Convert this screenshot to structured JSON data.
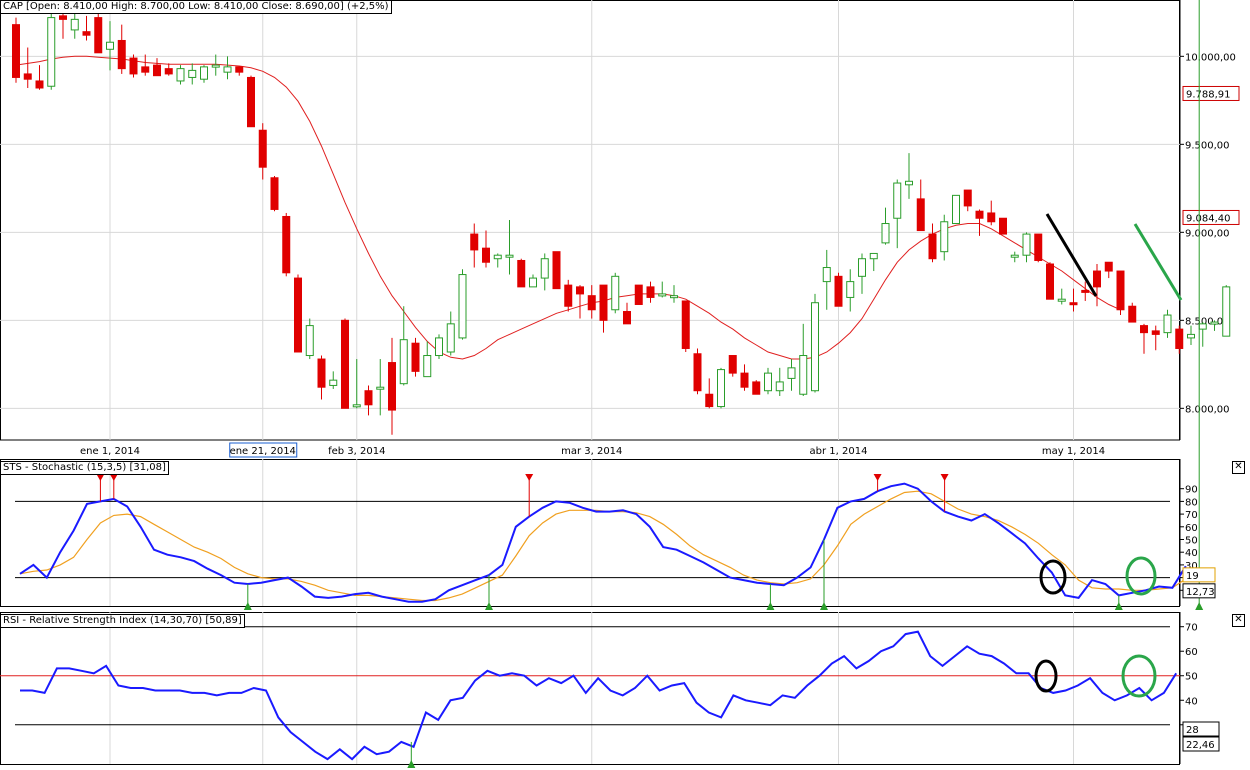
{
  "colors": {
    "up": "#2a9d2a",
    "down": "#e00000",
    "ma": "#e02020",
    "stoch_k": "#1a1aff",
    "stoch_d": "#f0a020",
    "rsi": "#1a1aff",
    "annot_black": "#000000",
    "annot_green": "#2aa64a"
  },
  "chart_data": [
    {
      "type": "candlestick",
      "title": "CAP [Open: 8.410,00 High: 8.700,00 Low: 8.410,00 Close: 8.690,00] (+2,5%)",
      "ylim": [
        7820,
        10320
      ],
      "y_ticks": [
        {
          "v": 8000,
          "t": "8.000,00"
        },
        {
          "v": 8500,
          "t": "8.500,00"
        },
        {
          "v": 9000,
          "t": "9.000,00"
        },
        {
          "v": 9500,
          "t": "9.500,00"
        },
        {
          "v": 10000,
          "t": "10.000,00"
        }
      ],
      "value_markers": [
        {
          "v": 9788.91,
          "t": "9.788,91",
          "color": "#cc0000"
        },
        {
          "v": 9084.4,
          "t": "9.084,40",
          "color": "#cc0000"
        }
      ],
      "x_labels": [
        {
          "i": 8,
          "t": "ene 1, 2014"
        },
        {
          "i": 21,
          "t": "ene 21, 2014",
          "boxed": true
        },
        {
          "i": 29,
          "t": "feb 3, 2014"
        },
        {
          "i": 49,
          "t": "mar 3, 2014"
        },
        {
          "i": 70,
          "t": "abr 1, 2014"
        },
        {
          "i": 90,
          "t": "may 1, 2014"
        }
      ],
      "candles": [
        [
          10180,
          10220,
          9850,
          9880
        ],
        [
          9900,
          10050,
          9820,
          9870
        ],
        [
          9860,
          9950,
          9810,
          9820
        ],
        [
          9830,
          10260,
          9810,
          10220
        ],
        [
          10230,
          10290,
          10100,
          10210
        ],
        [
          10150,
          10290,
          10100,
          10210
        ],
        [
          10140,
          10230,
          10090,
          10120
        ],
        [
          10220,
          10300,
          10020,
          10020
        ],
        [
          10040,
          10200,
          9920,
          10080
        ],
        [
          10090,
          10180,
          9900,
          9930
        ],
        [
          9990,
          10010,
          9880,
          9900
        ],
        [
          9940,
          10010,
          9890,
          9910
        ],
        [
          9950,
          9990,
          9890,
          9890
        ],
        [
          9930,
          9960,
          9890,
          9900
        ],
        [
          9860,
          9950,
          9840,
          9930
        ],
        [
          9880,
          9960,
          9840,
          9920
        ],
        [
          9870,
          9950,
          9850,
          9940
        ],
        [
          9940,
          10010,
          9890,
          9950
        ],
        [
          9910,
          10000,
          9870,
          9940
        ],
        [
          9940,
          9930,
          9890,
          9910
        ],
        [
          9880,
          9890,
          9600,
          9600
        ],
        [
          9580,
          9620,
          9300,
          9370
        ],
        [
          9310,
          9320,
          9120,
          9130
        ],
        [
          9090,
          9110,
          8750,
          8770
        ],
        [
          8740,
          8760,
          8320,
          8320
        ],
        [
          8300,
          8510,
          8280,
          8470
        ],
        [
          8280,
          8300,
          8050,
          8120
        ],
        [
          8130,
          8210,
          8110,
          8160
        ],
        [
          8500,
          8510,
          8000,
          8000
        ],
        [
          8010,
          8280,
          8000,
          8020
        ],
        [
          8100,
          8130,
          7960,
          8020
        ],
        [
          8120,
          8280,
          7960,
          8120
        ],
        [
          8260,
          8400,
          7850,
          7990
        ],
        [
          8140,
          8580,
          8130,
          8390
        ],
        [
          8370,
          8400,
          8180,
          8210
        ],
        [
          8180,
          8380,
          8180,
          8300
        ],
        [
          8300,
          8420,
          8280,
          8400
        ],
        [
          8320,
          8550,
          8300,
          8480
        ],
        [
          8400,
          8790,
          8390,
          8760
        ],
        [
          8990,
          9050,
          8800,
          8900
        ],
        [
          8910,
          9010,
          8800,
          8830
        ],
        [
          8850,
          8880,
          8800,
          8870
        ],
        [
          8870,
          9070,
          8760,
          8870
        ],
        [
          8840,
          8850,
          8700,
          8690
        ],
        [
          8690,
          8760,
          8690,
          8740
        ],
        [
          8740,
          8880,
          8670,
          8850
        ],
        [
          8890,
          8890,
          8800,
          8680
        ],
        [
          8700,
          8730,
          8550,
          8580
        ],
        [
          8690,
          8700,
          8510,
          8650
        ],
        [
          8640,
          8700,
          8510,
          8560
        ],
        [
          8700,
          8700,
          8430,
          8500
        ],
        [
          8560,
          8770,
          8540,
          8750
        ],
        [
          8550,
          8600,
          8500,
          8480
        ],
        [
          8700,
          8700,
          8610,
          8590
        ],
        [
          8690,
          8720,
          8600,
          8630
        ],
        [
          8650,
          8720,
          8630,
          8650
        ],
        [
          8640,
          8700,
          8600,
          8640
        ],
        [
          8610,
          8600,
          8320,
          8340
        ],
        [
          8310,
          8340,
          8080,
          8100
        ],
        [
          8080,
          8170,
          8000,
          8010
        ],
        [
          8010,
          8230,
          8000,
          8220
        ],
        [
          8300,
          8300,
          8180,
          8200
        ],
        [
          8200,
          8250,
          8100,
          8120
        ],
        [
          8150,
          8160,
          8100,
          8080
        ],
        [
          8100,
          8230,
          8080,
          8200
        ],
        [
          8100,
          8230,
          8070,
          8150
        ],
        [
          8170,
          8280,
          8100,
          8230
        ],
        [
          8080,
          8480,
          8070,
          8300
        ],
        [
          8100,
          8650,
          8090,
          8600
        ],
        [
          8720,
          8900,
          8560,
          8800
        ],
        [
          8750,
          8770,
          8660,
          8580
        ],
        [
          8630,
          8790,
          8550,
          8720
        ],
        [
          8750,
          8880,
          8650,
          8850
        ],
        [
          8850,
          8880,
          8780,
          8880
        ],
        [
          8940,
          9140,
          8930,
          9050
        ],
        [
          9080,
          9300,
          8910,
          9280
        ],
        [
          9270,
          9450,
          9190,
          9290
        ],
        [
          9190,
          9300,
          9020,
          9010
        ],
        [
          8990,
          9050,
          8830,
          8850
        ],
        [
          8890,
          9100,
          8840,
          9060
        ],
        [
          9050,
          9200,
          9050,
          9210
        ],
        [
          9240,
          9220,
          9120,
          9150
        ],
        [
          9120,
          9130,
          8980,
          9080
        ],
        [
          9110,
          9180,
          9040,
          9060
        ],
        [
          9080,
          9070,
          9000,
          8990
        ],
        [
          8860,
          8890,
          8830,
          8870
        ],
        [
          8870,
          9000,
          8830,
          8990
        ],
        [
          8990,
          8990,
          8830,
          8840
        ],
        [
          8820,
          8830,
          8620,
          8620
        ],
        [
          8620,
          8680,
          8590,
          8620
        ],
        [
          8600,
          8680,
          8550,
          8590
        ],
        [
          8670,
          8720,
          8610,
          8660
        ],
        [
          8780,
          8820,
          8580,
          8690
        ],
        [
          8830,
          8820,
          8740,
          8780
        ],
        [
          8780,
          8750,
          8530,
          8560
        ],
        [
          8580,
          8600,
          8500,
          8490
        ],
        [
          8470,
          8480,
          8310,
          8430
        ],
        [
          8440,
          8470,
          8330,
          8420
        ],
        [
          8430,
          8560,
          8400,
          8530
        ],
        [
          8450,
          8470,
          8310,
          8340
        ],
        [
          8400,
          8470,
          8360,
          8420
        ],
        [
          8450,
          8490,
          8350,
          8480
        ],
        [
          8480,
          8500,
          8440,
          8490
        ],
        [
          8410,
          8700,
          8410,
          8690
        ]
      ],
      "ma": [
        9950,
        9960,
        9970,
        9985,
        9995,
        10000,
        10000,
        9995,
        9990,
        9985,
        9975,
        9965,
        9960,
        9955,
        9955,
        9955,
        9955,
        9955,
        9950,
        9945,
        9935,
        9915,
        9880,
        9825,
        9745,
        9630,
        9490,
        9330,
        9170,
        9020,
        8880,
        8750,
        8640,
        8550,
        8460,
        8380,
        8320,
        8290,
        8280,
        8300,
        8340,
        8390,
        8420,
        8450,
        8480,
        8510,
        8540,
        8560,
        8580,
        8600,
        8610,
        8630,
        8640,
        8650,
        8650,
        8650,
        8640,
        8620,
        8580,
        8540,
        8490,
        8450,
        8400,
        8360,
        8320,
        8300,
        8280,
        8280,
        8290,
        8320,
        8370,
        8430,
        8510,
        8620,
        8730,
        8830,
        8900,
        8950,
        8990,
        9020,
        9040,
        9050,
        9050,
        9020,
        8980,
        8940,
        8900,
        8860,
        8820,
        8780,
        8730,
        8680,
        8630,
        8590,
        8560
      ]
    },
    {
      "type": "line",
      "title": "STS - Stochastic (15,3,5) [31,08]",
      "ylim": [
        0,
        100
      ],
      "y_ticks": [
        10,
        20,
        30,
        40,
        50,
        60,
        70,
        80,
        90
      ],
      "hlines": [
        20,
        80
      ],
      "value_markers": [
        {
          "v": 19,
          "t": "19",
          "color": "#e0a000"
        },
        {
          "v": 12.73,
          "t": "12,73",
          "color": "#000"
        }
      ],
      "series": [
        {
          "values": [
            23,
            30,
            20,
            40,
            57,
            78,
            80,
            82,
            76,
            60,
            42,
            38,
            36,
            33,
            27,
            22,
            16,
            15,
            16,
            18,
            20,
            13,
            5,
            4,
            5,
            7,
            8,
            5,
            3,
            1,
            1,
            3,
            10,
            14,
            18,
            22,
            30,
            60,
            68,
            75,
            80,
            79,
            75,
            72,
            72,
            73,
            70,
            60,
            44,
            42,
            37,
            32,
            26,
            20,
            18,
            16,
            15,
            14,
            20,
            28,
            50,
            75,
            80,
            82,
            88,
            92,
            94,
            90,
            80,
            72,
            68,
            65,
            70,
            63,
            55,
            47,
            35,
            24,
            6,
            4,
            18,
            15,
            6,
            8,
            10,
            13,
            12,
            29
          ]
        },
        {
          "values": [
            23,
            25,
            26,
            30,
            36,
            50,
            63,
            69,
            70,
            68,
            62,
            56,
            50,
            44,
            40,
            35,
            28,
            23,
            20,
            19,
            19,
            17,
            14,
            10,
            8,
            6,
            6,
            5,
            4,
            3,
            2,
            2,
            4,
            7,
            12,
            17,
            22,
            37,
            53,
            63,
            70,
            73,
            73,
            73,
            72,
            72,
            71,
            68,
            62,
            54,
            45,
            38,
            33,
            28,
            22,
            18,
            16,
            15,
            16,
            19,
            30,
            45,
            62,
            70,
            76,
            82,
            87,
            88,
            86,
            80,
            74,
            70,
            68,
            65,
            60,
            54,
            47,
            38,
            30,
            18,
            12,
            11,
            11,
            10,
            10,
            11,
            12,
            19
          ]
        }
      ],
      "markers_down_idx": [
        6,
        7,
        38,
        64,
        69
      ],
      "markers_up_idx": [
        17,
        35,
        56,
        60,
        82,
        88
      ]
    },
    {
      "type": "line",
      "title": "RSI - Relative Strength Index (14,30,70) [50,89]",
      "ylim": [
        14,
        76
      ],
      "y_ticks": [
        30,
        40,
        50,
        60,
        70
      ],
      "hlines": [
        30,
        70
      ],
      "midline": 50,
      "value_markers": [
        {
          "v": 28,
          "t": "28",
          "color": "#000"
        },
        {
          "v": 22.46,
          "t": "22,46",
          "color": "#000"
        }
      ],
      "series": [
        {
          "values": [
            44,
            44,
            43,
            53,
            53,
            52,
            51,
            54,
            46,
            45,
            45,
            44,
            44,
            44,
            43,
            43,
            42,
            43,
            43,
            45,
            44,
            33,
            27,
            23,
            19,
            16,
            20,
            16,
            21,
            18,
            19,
            23,
            21,
            35,
            32,
            40,
            41,
            48,
            52,
            50,
            51,
            50,
            46,
            49,
            47,
            50,
            43,
            49,
            44,
            42,
            45,
            50,
            44,
            46,
            47,
            39,
            35,
            33,
            42,
            40,
            39,
            38,
            42,
            41,
            46,
            50,
            55,
            58,
            53,
            56,
            60,
            62,
            67,
            68,
            58,
            54,
            58,
            62,
            59,
            58,
            55,
            51,
            51,
            45,
            43,
            44,
            46,
            49,
            43,
            40,
            42,
            45,
            40,
            43,
            51
          ]
        }
      ],
      "markers_up_idx": [
        31
      ]
    }
  ]
}
